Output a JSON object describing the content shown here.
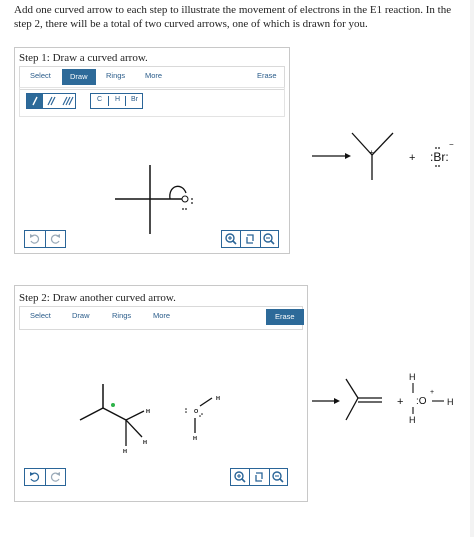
{
  "instructions": "Add one curved arrow to each step to illustrate the movement of electrons in the E1 reaction. In the step 2, there will be a total of two curved arrows, one of which is drawn for you.",
  "step1": {
    "title": "Step 1: Draw a curved arrow.",
    "tabs": [
      "Select",
      "Draw",
      "Rings",
      "More"
    ],
    "active_tab": "Draw",
    "erase": "Erase",
    "atoms": [
      "C",
      "H",
      "Br"
    ],
    "bond_icons": [
      "single-bond",
      "double-bond",
      "triple-bond"
    ],
    "undo_icon": "undo-icon",
    "redo_icon": "redo-icon",
    "zoom_icons": [
      "zoom-in-icon",
      "reset-zoom-icon",
      "zoom-out-icon"
    ]
  },
  "step1_products": {
    "plus": "+",
    "bromide": ":Br:",
    "charge_plus": "+",
    "charge_minus": "−"
  },
  "step2": {
    "title": "Step 2: Draw another curved arrow.",
    "tabs": [
      "Select",
      "Draw",
      "Rings",
      "More"
    ],
    "erase": "Erase",
    "atom_h": "H",
    "atom_o": "O"
  },
  "step2_products": {
    "plus": "+",
    "h_top": "H",
    "h_bottom": "H",
    "oxygen": ":O",
    "h_right": "H",
    "charge_plus": "+"
  },
  "colors": {
    "accent": "#2d6a99",
    "border": "#c8c8c8"
  }
}
